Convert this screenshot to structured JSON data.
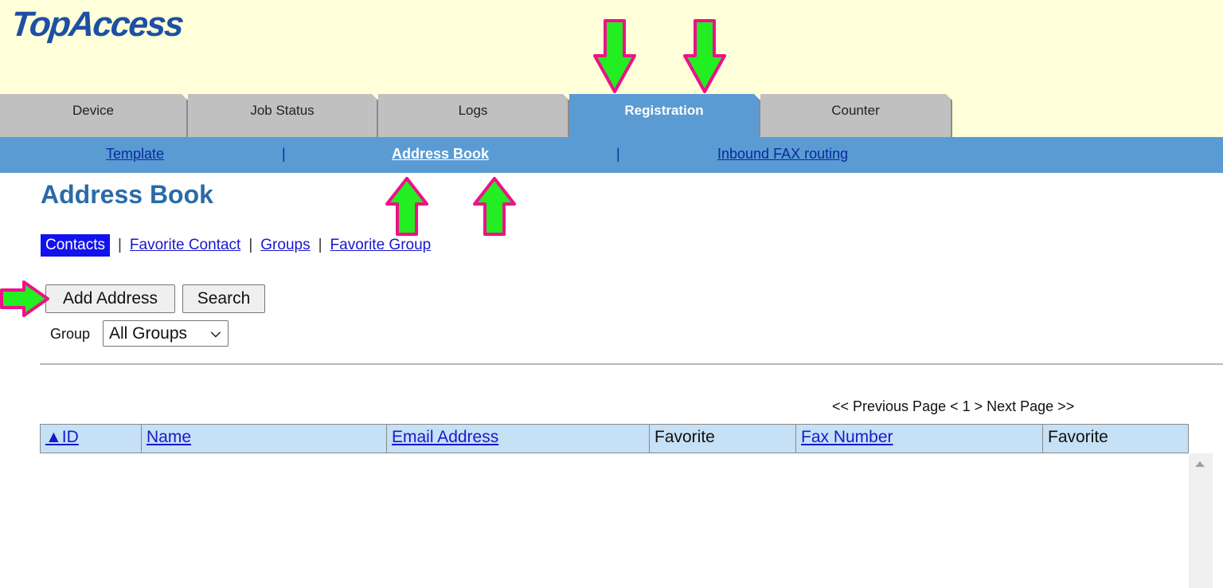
{
  "app": {
    "logo_text": "TopAccess"
  },
  "tabs": [
    {
      "label": "Device"
    },
    {
      "label": "Job Status"
    },
    {
      "label": "Logs"
    },
    {
      "label": "Registration",
      "active": true
    },
    {
      "label": "Counter"
    }
  ],
  "subnav": {
    "items": [
      "Template",
      "Address Book",
      "Inbound FAX routing"
    ],
    "separator": "|",
    "current": "Address Book"
  },
  "page": {
    "title": "Address Book"
  },
  "views": {
    "current": "Contacts",
    "links": [
      "Favorite Contact",
      "Groups",
      "Favorite Group"
    ],
    "separator": "|"
  },
  "buttons": {
    "add_address": "Add Address",
    "search": "Search"
  },
  "group_filter": {
    "label": "Group",
    "selected": "All Groups"
  },
  "pager": {
    "text": "<< Previous Page < 1 > Next Page >>"
  },
  "table": {
    "columns": [
      "▲ID",
      "Name",
      "Email Address",
      "Favorite",
      "Fax Number",
      "Favorite"
    ],
    "rows": []
  },
  "colors": {
    "header_bg": "#ffffd9",
    "tab_inactive": "#c0c0c0",
    "tab_active": "#5a9bd4",
    "subnav_bg": "#5a9bd4",
    "title": "#2a6ba6",
    "annotation_arrow_fill": "#22ee22",
    "annotation_arrow_stroke": "#ee1188"
  },
  "icons": {
    "select_caret": "chevron-down-icon",
    "scroll_up": "arrow-up-icon",
    "annotation": "arrow-annotation-icon"
  }
}
